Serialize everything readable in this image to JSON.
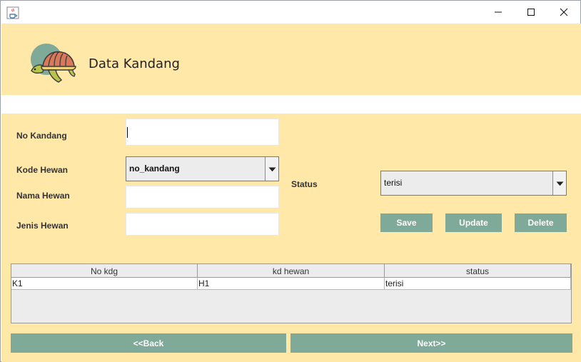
{
  "window": {
    "app_icon": "java-cup-icon",
    "controls": [
      "minimize-icon",
      "maximize-icon",
      "close-icon"
    ]
  },
  "header": {
    "title": "Data Kandang",
    "logo": "turtle-icon"
  },
  "form": {
    "no_kandang_label": "No Kandang",
    "no_kandang_value": "",
    "kode_hewan_label": "Kode Hewan",
    "kode_hewan_selected": "no_kandang",
    "nama_hewan_label": "Nama Hewan",
    "nama_hewan_value": "",
    "jenis_hewan_label": "Jenis Hewan",
    "jenis_hewan_value": "",
    "status_label": "Status",
    "status_selected": "terisi"
  },
  "actions": {
    "save_label": "Save",
    "update_label": "Update",
    "delete_label": "Delete"
  },
  "table": {
    "columns": [
      "No kdg",
      "kd hewan",
      "status"
    ],
    "rows": [
      [
        "K1",
        "H1",
        "terisi"
      ]
    ]
  },
  "nav": {
    "back_label": "<<Back",
    "next_label": "Next>>"
  },
  "colors": {
    "background": "#ffe8a8",
    "button": "#7fa998",
    "button_text": "#ffffff"
  }
}
